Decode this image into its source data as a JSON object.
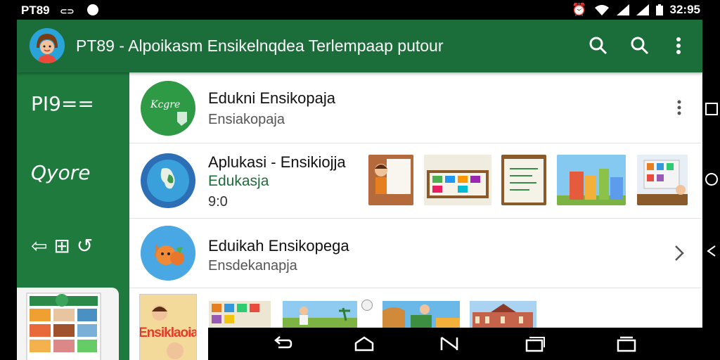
{
  "status_bar": {
    "left_text": "PT89",
    "time": "32:95"
  },
  "app_bar": {
    "title": "PT89 - Alpoikasm Ensikelnqdea Terlempaap putour",
    "icons": [
      "search-icon",
      "search-icon",
      "more-vert-icon"
    ]
  },
  "sidebar": {
    "items": [
      {
        "label": "PI9=="
      },
      {
        "label": "Qyore"
      },
      {
        "label": "⇦ ⊞ ↺"
      }
    ]
  },
  "list": {
    "rows": [
      {
        "title": "Edukni Ensikopaja",
        "subtitle": "Ensiakopaja",
        "icon_text": "Kcgre",
        "action": "more-vert-icon"
      },
      {
        "title": "Aplukasi - Ensikiojja",
        "green_text": "Edukasja",
        "value": "9:0"
      },
      {
        "title": "Eduikah Ensikopega",
        "subtitle": "Ensdekanapja",
        "action": "chevron-right-icon"
      }
    ],
    "book_cover_text": "Ensiklaoia"
  },
  "colors": {
    "appbar": "#1b6d3a",
    "sidebar": "#1e7a3d",
    "accent_green": "#1b6d3a"
  }
}
